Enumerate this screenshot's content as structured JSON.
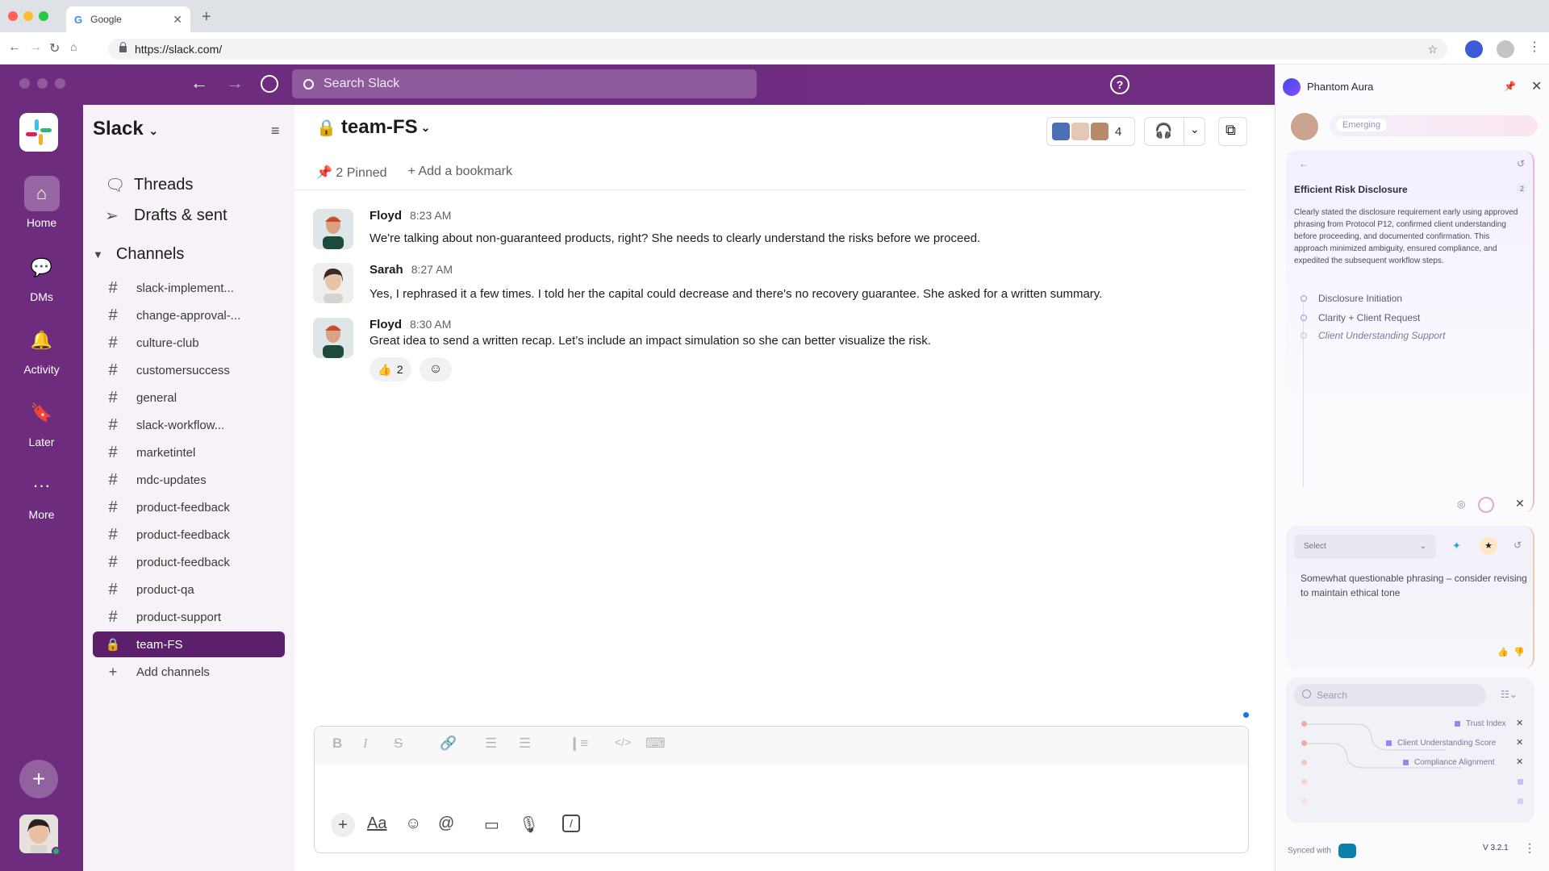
{
  "browser": {
    "tab_title": "Google",
    "tab_favicon": "G",
    "url": "https://slack.com/"
  },
  "slack": {
    "search_placeholder": "Search Slack",
    "rail": {
      "home": "Home",
      "dms": "DMs",
      "activity": "Activity",
      "later": "Later",
      "more": "More"
    },
    "workspace_name": "Slack",
    "sidebar": {
      "threads": "Threads",
      "drafts": "Drafts & sent",
      "channels_header": "Channels",
      "channels": [
        "slack-implement...",
        "change-approval-...",
        "culture-club",
        "customersuccess",
        "general",
        "slack-workflow...",
        "marketintel",
        "mdc-updates",
        "product-feedback",
        "product-feedback",
        "product-feedback",
        "product-qa",
        "product-support",
        "team-FS"
      ],
      "add_channels": "Add channels"
    },
    "channel": {
      "title": "team-FS",
      "member_count": "4",
      "pinned": "2 Pinned",
      "add_bookmark": "Add a bookmark"
    },
    "messages": [
      {
        "author": "Floyd",
        "time": "8:23 AM",
        "text": "We're talking about non-guaranteed products, right? She needs to clearly understand the risks before we proceed."
      },
      {
        "author": "Sarah",
        "time": "8:27 AM",
        "text": "Yes, I rephrased it a few times. I told her the capital could decrease and there's no recovery guarantee. She asked for a written summary."
      },
      {
        "author": "Floyd",
        "time": "8:30 AM",
        "text": "Great idea to send a written recap. Let’s include an impact simulation so she can better visualize the risk."
      }
    ],
    "reaction": {
      "emoji": "👍",
      "count": "2"
    }
  },
  "phantom": {
    "title": "Phantom  Aura",
    "badge": "Emerging",
    "card_title": "Efficient Risk Disclosure",
    "card_count": "2",
    "card_body": "Clearly stated the disclosure requirement early using approved phrasing  from Protocol P12, confirmed client understanding before proceeding, and documented confirmation. This approach minimized ambiguity, ensured  compliance, and expedited the subsequent workflow steps.",
    "steps": [
      "Disclosure Initiation",
      "Clarity + Client Request",
      "Client Understanding Support"
    ],
    "select_label": "Select",
    "feedback": "Somewhat questionable phrasing – consider revising to maintain ethical tone",
    "search_placeholder": "Search",
    "metrics": [
      "Trust Index",
      "Client Understanding Score",
      "Compliance Alignment"
    ],
    "synced_with": "Synced with",
    "version": "V 3.2.1"
  },
  "colors": {
    "slack_purple": "#6e2c7f",
    "active_channel": "#5b1f6b",
    "accent_blue": "#1a73e8"
  }
}
